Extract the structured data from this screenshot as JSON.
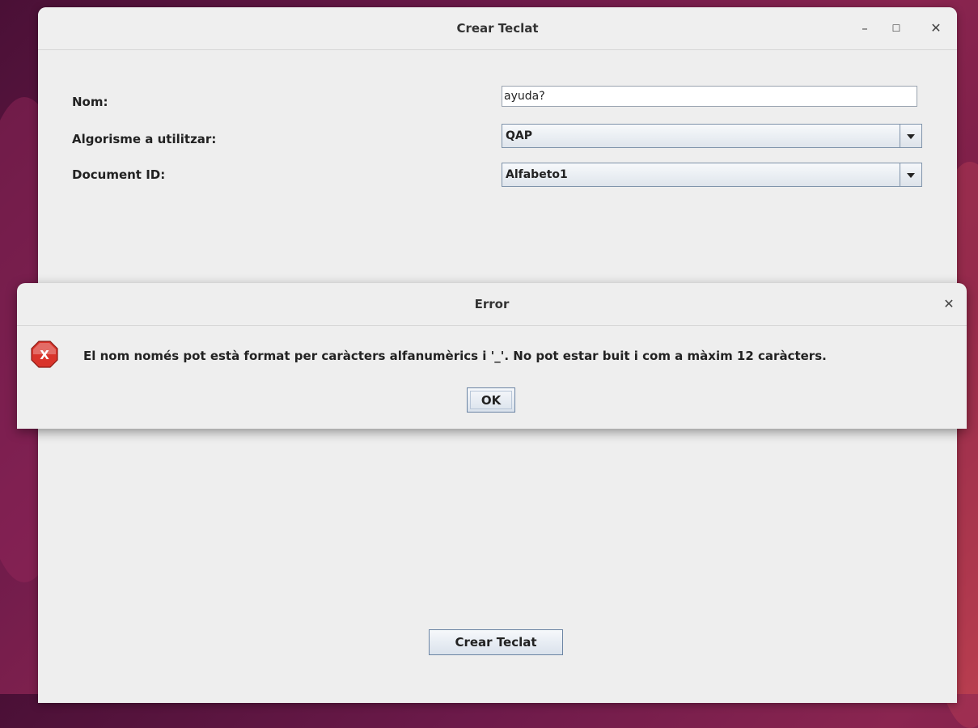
{
  "main_window": {
    "title": "Crear Teclat",
    "controls": {
      "minimize": "–",
      "maximize": "☐",
      "close": "✕"
    },
    "form": {
      "name_label": "Nom:",
      "name_value": "ayuda?",
      "algorithm_label": "Algorisme a utilitzar:",
      "algorithm_selected": "QAP",
      "document_label": "Document ID:",
      "document_selected": "Alfabeto1"
    },
    "create_button": "Crear Teclat"
  },
  "error_dialog": {
    "title": "Error",
    "close": "✕",
    "icon": "error-x-icon",
    "icon_glyph": "X",
    "message": "El nom només pot està format per caràcters alfanumèrics i '_'. No pot estar buit i com a màxim 12 caràcters.",
    "ok_label": "OK"
  },
  "colors": {
    "window_bg": "#eeeeee",
    "error_icon": "#d9342b",
    "button_border": "#6b84a3"
  }
}
